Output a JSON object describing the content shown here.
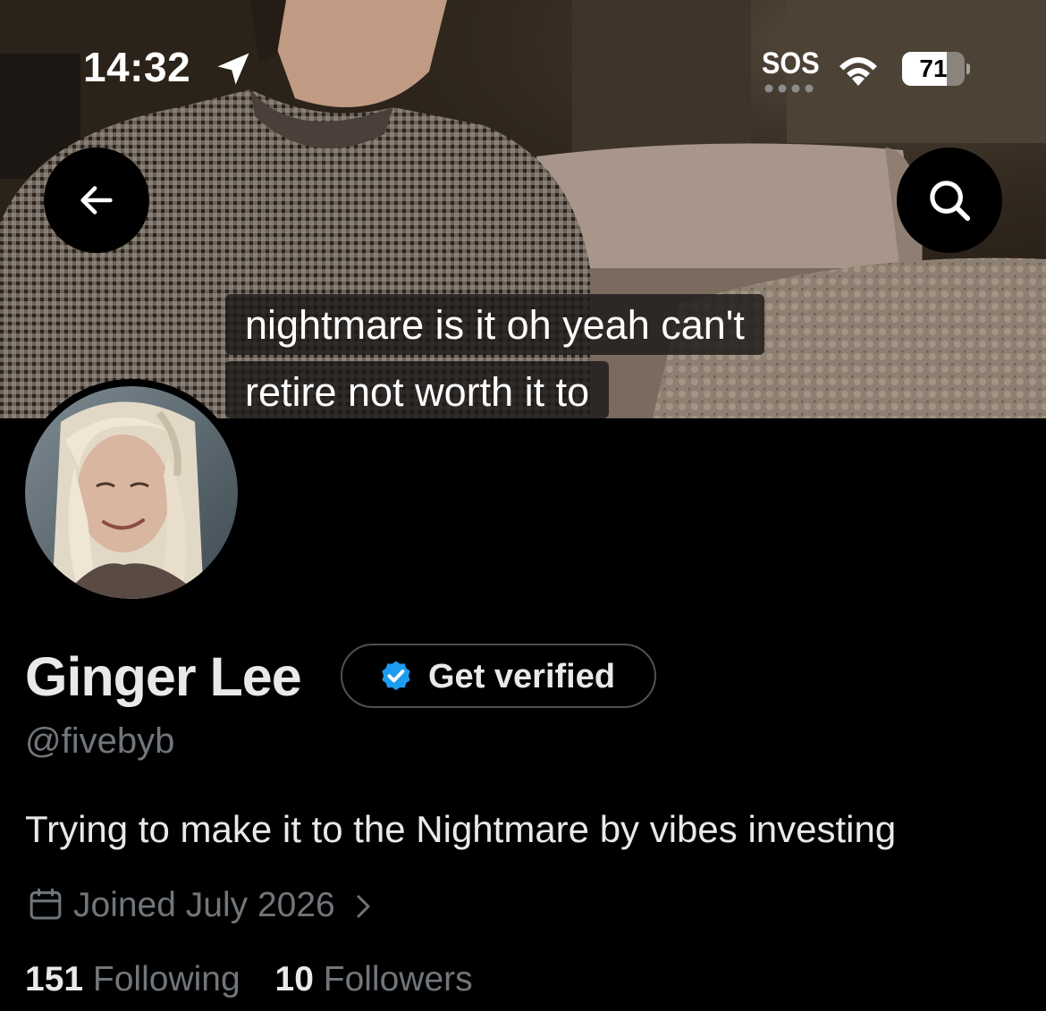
{
  "status_bar": {
    "time": "14:32",
    "sos": "SOS",
    "battery_level": "71",
    "battery_fraction": 0.71
  },
  "header": {
    "back_icon": "arrow-left-icon",
    "search_icon": "search-icon"
  },
  "banner": {
    "caption_line_1": "nightmare is it oh yeah can't",
    "caption_line_2": "retire not worth it to"
  },
  "profile": {
    "display_name": "Ginger Lee",
    "get_verified_label": "Get verified",
    "handle": "@fivebyb",
    "bio": "Trying to make it to the Nightmare by vibes investing",
    "joined": "Joined July 2026",
    "following_count": "151",
    "following_label": "Following",
    "followers_count": "10",
    "followers_label": "Followers"
  },
  "colors": {
    "background": "#000000",
    "text_primary": "#e7e9ea",
    "text_secondary": "#71767b",
    "verified_blue": "#1d9bf0",
    "button_border": "#4b5157"
  }
}
